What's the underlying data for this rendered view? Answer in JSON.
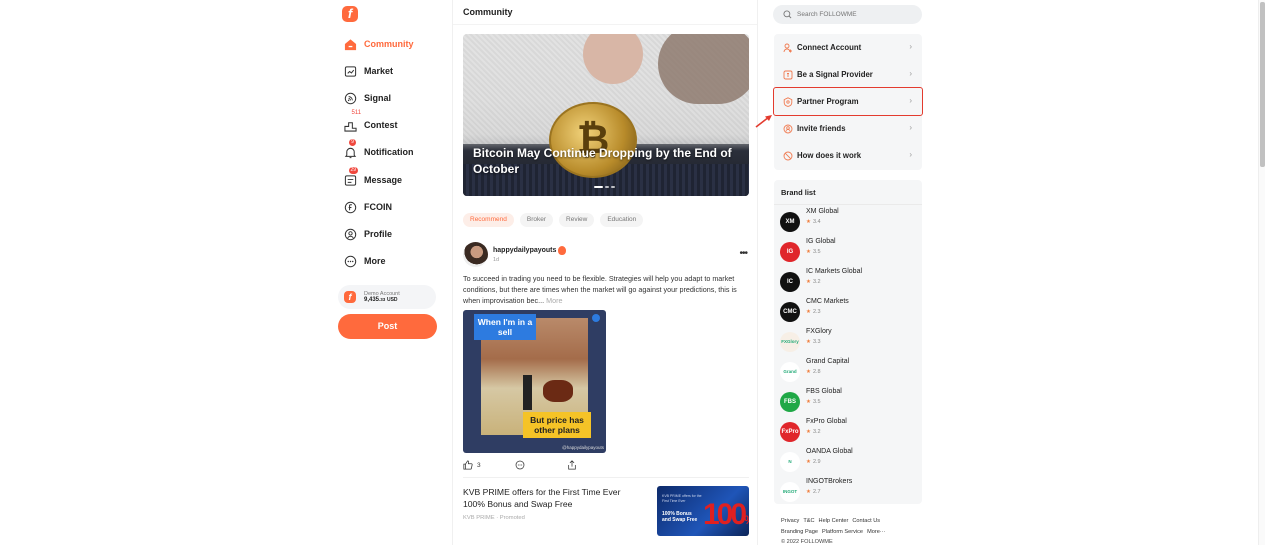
{
  "app": {
    "brand": "FOLLOWME",
    "accent": "#ff6a3d",
    "highlight": "#e33b2e"
  },
  "sidebar": {
    "items": [
      {
        "label": "Community",
        "icon": "home-icon",
        "active": true
      },
      {
        "label": "Market",
        "icon": "chart-icon"
      },
      {
        "label": "Signal",
        "icon": "signal-icon"
      },
      {
        "label": "Contest",
        "icon": "podium-icon",
        "badge": "511"
      },
      {
        "label": "Notification",
        "icon": "bell-icon",
        "badge": "9"
      },
      {
        "label": "Message",
        "icon": "message-icon",
        "badge": "29"
      },
      {
        "label": "FCOIN",
        "icon": "coin-icon"
      },
      {
        "label": "Profile",
        "icon": "profile-icon"
      },
      {
        "label": "More",
        "icon": "more-icon"
      }
    ],
    "account": {
      "type": "Demo Account",
      "balance_main": "9,435",
      "balance_cents": ".33",
      "currency": "USD"
    },
    "post_label": "Post"
  },
  "main": {
    "title": "Community",
    "hero": {
      "title": "Bitcoin May Continue Dropping by the End of October",
      "slides": 3,
      "active_slide": 1
    },
    "tabs": [
      {
        "label": "Recommend",
        "active": true
      },
      {
        "label": "Broker"
      },
      {
        "label": "Review"
      },
      {
        "label": "Education"
      }
    ],
    "post": {
      "author": "happydailypayouts",
      "time": "1d",
      "text": "To succeed in trading you need to be flexible. Strategies will help you adapt to market conditions, but there are times when the market will go against your predictions, this is when improvisation bec...",
      "more_label": "More",
      "image_caption_top": "When I'm in a sell",
      "image_caption_bottom": "But price has other plans",
      "image_watermark": "@happydailypayouts",
      "likes": "3"
    },
    "ad": {
      "title": "KVB PRIME offers for the First Time Ever 100% Bonus and Swap Free",
      "source": "KVB PRIME",
      "tag": "Promoted",
      "image_small": "KVB PRIME offers for the First Time Ever",
      "image_headline": "100% Bonus and Swap Free",
      "image_big": "100"
    }
  },
  "right": {
    "search_placeholder": "Search FOLLOWME",
    "menu": [
      {
        "label": "Connect Account",
        "icon": "user-plus-icon"
      },
      {
        "label": "Be a Signal Provider",
        "icon": "signal-provider-icon"
      },
      {
        "label": "Partner Program",
        "icon": "partner-icon",
        "highlighted": true
      },
      {
        "label": "Invite friends",
        "icon": "invite-icon"
      },
      {
        "label": "How does it work",
        "icon": "help-icon"
      }
    ],
    "brand_list_title": "Brand list",
    "brands": [
      {
        "name": "XM Global",
        "rating": "3.4",
        "logo_text": "XM",
        "color": "#111111"
      },
      {
        "name": "IG Global",
        "rating": "3.5",
        "logo_text": "IG",
        "color": "#e0262b"
      },
      {
        "name": "IC Markets Global",
        "rating": "3.2",
        "logo_text": "IC",
        "color": "#111111"
      },
      {
        "name": "CMC Markets",
        "rating": "2.3",
        "logo_text": "CMC",
        "color": "#111111"
      },
      {
        "name": "FXGlory",
        "rating": "3.3",
        "logo_text": "FXGlory",
        "color": "#f7efe6"
      },
      {
        "name": "Grand Capital",
        "rating": "2.8",
        "logo_text": "Grand",
        "color": "#ffffff"
      },
      {
        "name": "FBS Global",
        "rating": "3.5",
        "logo_text": "FBS",
        "color": "#1fa846"
      },
      {
        "name": "FxPro Global",
        "rating": "3.2",
        "logo_text": "FxPro",
        "color": "#e0262b"
      },
      {
        "name": "OANDA Global",
        "rating": "2.9",
        "logo_text": "N",
        "color": "#ffffff"
      },
      {
        "name": "INGOTBrokers",
        "rating": "2.7",
        "logo_text": "INGOT",
        "color": "#ffffff"
      }
    ],
    "footer": {
      "links": [
        "Privacy",
        "T&C",
        "Help Center",
        "Contact Us",
        "Branding Page",
        "Platform Service",
        "More···"
      ],
      "copyright": "© 2022 FOLLOWME"
    }
  }
}
